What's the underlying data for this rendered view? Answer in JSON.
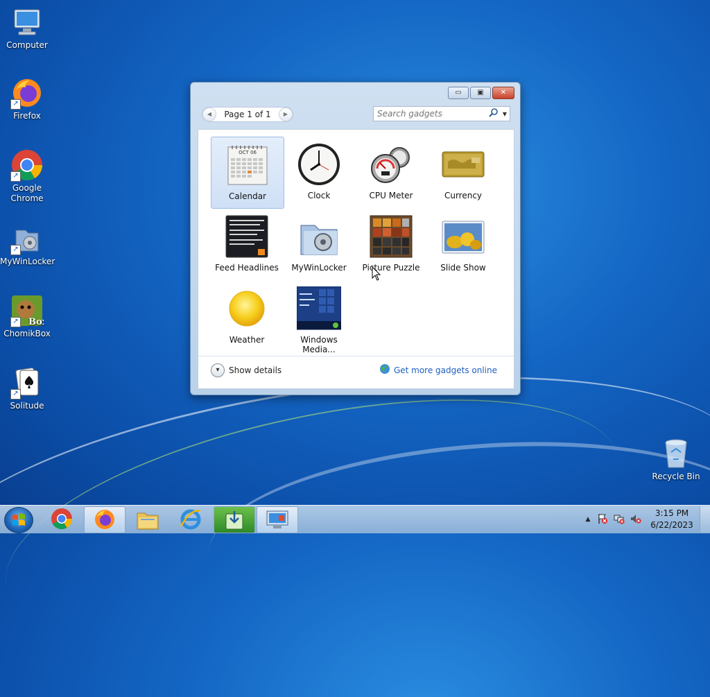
{
  "desktop": {
    "icons": [
      {
        "label": "Computer"
      },
      {
        "label": "Firefox"
      },
      {
        "label": "Google Chrome"
      },
      {
        "label": "MyWinLocker"
      },
      {
        "label": "ChomikBox"
      },
      {
        "label": "Solitude"
      }
    ],
    "recycle_bin": {
      "label": "Recycle Bin"
    }
  },
  "gadget_window": {
    "page_label": "Page 1 of 1",
    "search": {
      "placeholder": "Search gadgets"
    },
    "gadgets": [
      {
        "label": "Calendar",
        "selected": true
      },
      {
        "label": "Clock"
      },
      {
        "label": "CPU Meter"
      },
      {
        "label": "Currency"
      },
      {
        "label": "Feed Headlines"
      },
      {
        "label": "MyWinLocker"
      },
      {
        "label": "Picture Puzzle"
      },
      {
        "label": "Slide Show"
      },
      {
        "label": "Weather"
      },
      {
        "label": "Windows Media..."
      }
    ],
    "calendar_month": "OCT 06",
    "show_details": "Show details",
    "get_more": "Get more gadgets online"
  },
  "taskbar": {
    "time": "3:15 PM",
    "date": "6/22/2023",
    "pinned": [
      "chrome",
      "firefox",
      "explorer",
      "internet-explorer",
      "app-green",
      "app-screen"
    ]
  },
  "colors": {
    "link": "#1e5fbf",
    "desktop_blue": "#1466c4"
  }
}
